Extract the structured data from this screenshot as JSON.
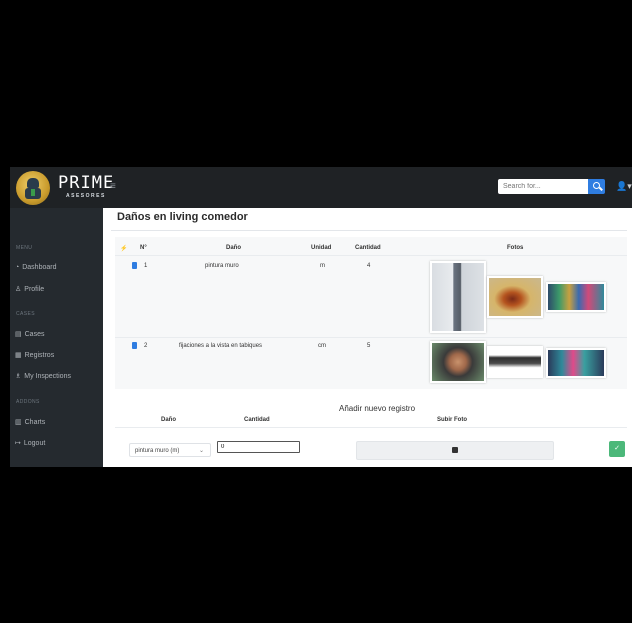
{
  "brand": {
    "name": "PRIME",
    "subtitle": "ASESORES"
  },
  "header": {
    "search_placeholder": "Search for...",
    "menu_icon": "menu-icon",
    "search_icon": "search-icon",
    "user_icon": "user-icon"
  },
  "sidebar": {
    "sections": [
      {
        "heading": "MENU",
        "items": [
          {
            "label": "Dashboard",
            "icon": "dashboard-icon"
          },
          {
            "label": "Profile",
            "icon": "profile-icon"
          }
        ]
      },
      {
        "heading": "CASES",
        "items": [
          {
            "label": "Cases",
            "icon": "cases-icon"
          },
          {
            "label": "Registros",
            "icon": "registros-icon"
          },
          {
            "label": "My Inspections",
            "icon": "inspections-icon"
          }
        ]
      },
      {
        "heading": "ADDONS",
        "items": [
          {
            "label": "Charts",
            "icon": "chart-icon"
          },
          {
            "label": "Logout",
            "icon": "logout-icon"
          }
        ]
      }
    ]
  },
  "main": {
    "title_prefix": "Daños en",
    "title_place": "living comedor",
    "table": {
      "headers": {
        "action": "⚡",
        "num": "N°",
        "dano": "Daño",
        "unidad": "Unidad",
        "cantidad": "Cantidad",
        "fotos": "Fotos"
      },
      "rows": [
        {
          "num": "1",
          "dano": "pintura muro",
          "unidad": "m",
          "cantidad": "4"
        },
        {
          "num": "2",
          "dano": "fijaciones a la vista en tabiques",
          "unidad": "cm",
          "cantidad": "5"
        }
      ]
    },
    "form": {
      "title": "Añadir nuevo registro",
      "headers": {
        "dano": "Daño",
        "cantidad": "Cantidad",
        "foto": "Subir Foto"
      },
      "select_value": "pintura muro (m)",
      "qty_value": "0",
      "save_icon": "check-icon",
      "upload_icon": "image-icon"
    }
  }
}
